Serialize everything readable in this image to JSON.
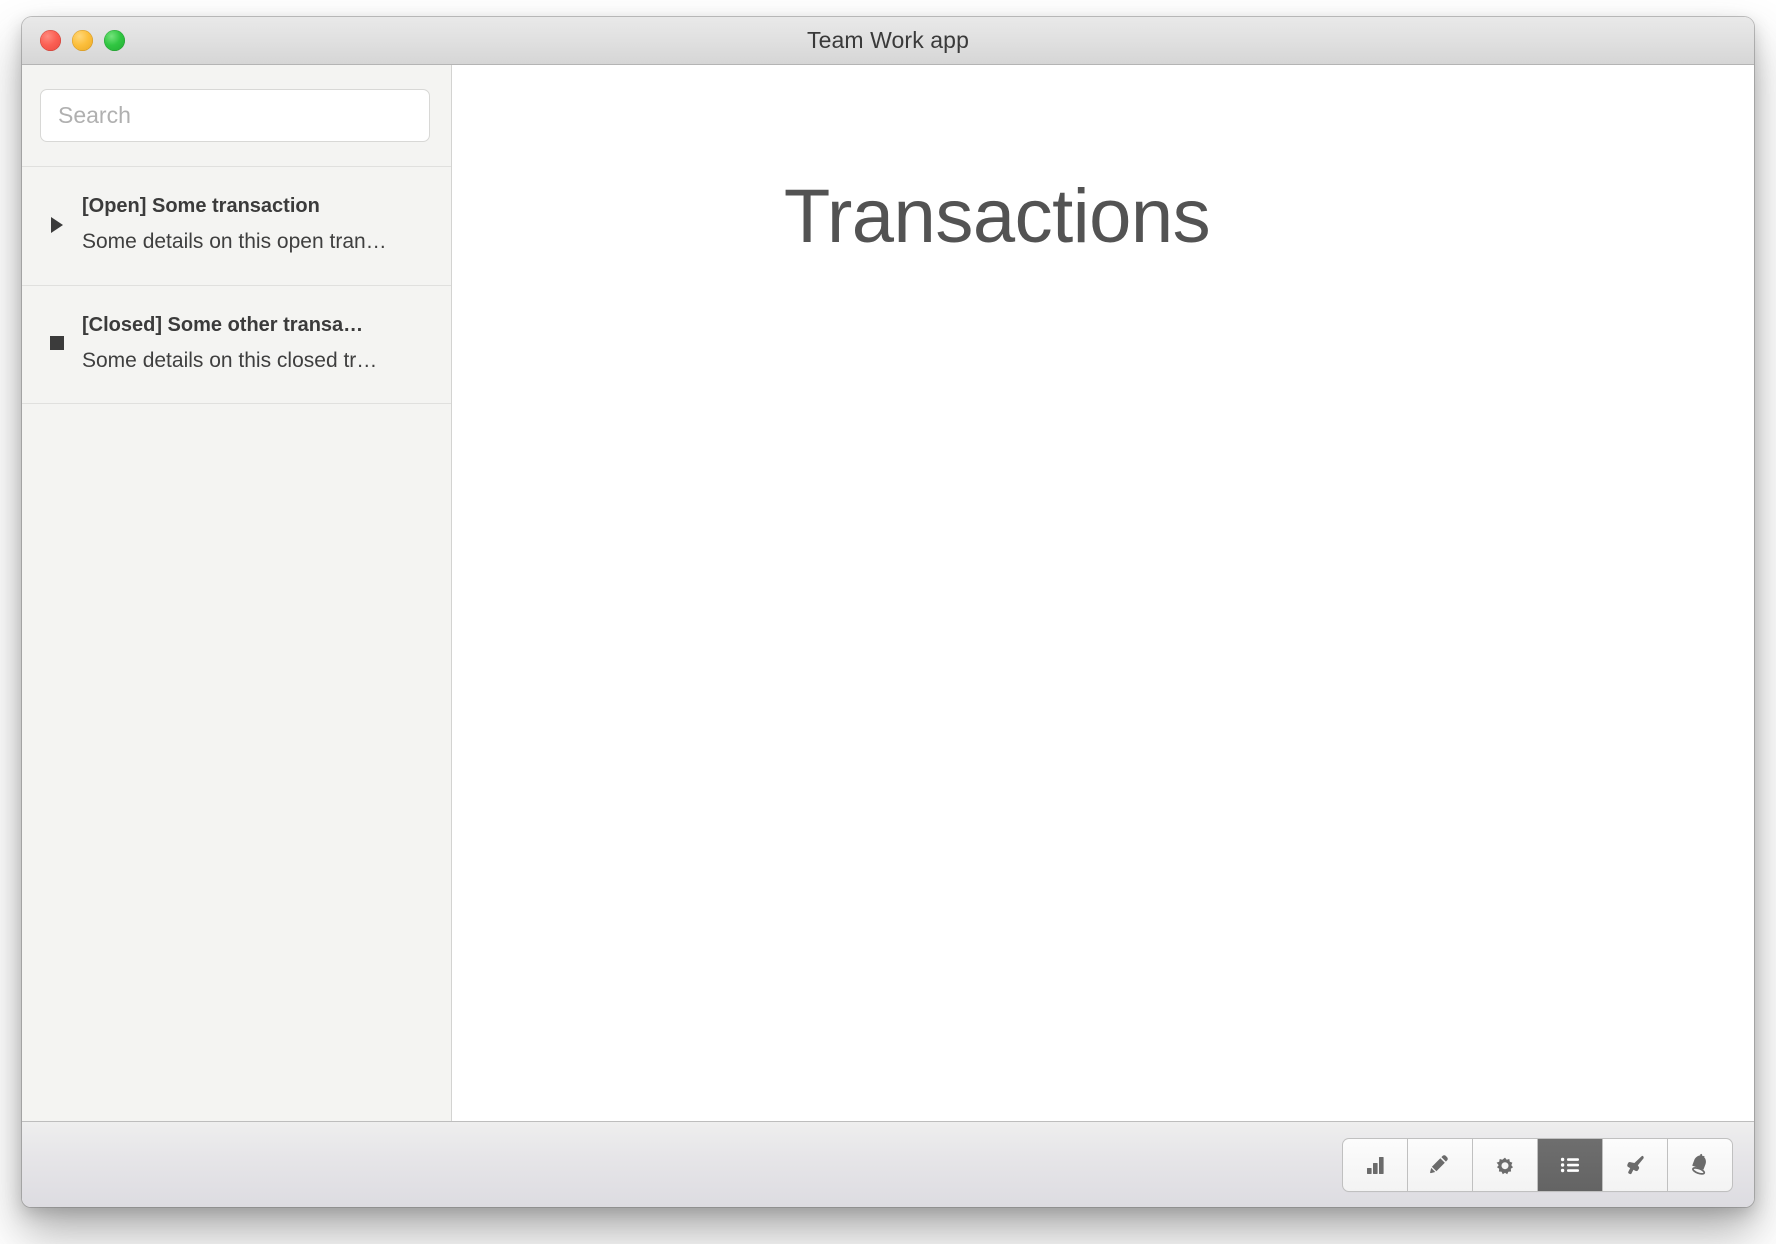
{
  "window": {
    "title": "Team Work app",
    "traffic_lights": [
      {
        "name": "close-button",
        "color": "#fb6054"
      },
      {
        "name": "minimize-button",
        "color": "#fcbf3c"
      },
      {
        "name": "zoom-button",
        "color": "#31c642"
      }
    ]
  },
  "sidebar": {
    "search": {
      "placeholder": "Search",
      "value": ""
    },
    "transactions": [
      {
        "icon": "triangle-play-icon",
        "status": "Open",
        "title": "[Open] Some transaction",
        "detail": "Some details on this open tran…"
      },
      {
        "icon": "square-stop-icon",
        "status": "Closed",
        "title": "[Closed] Some other transa…",
        "detail": "Some details on this closed tr…"
      }
    ]
  },
  "main": {
    "title": "Transactions"
  },
  "toolbar": {
    "buttons": [
      {
        "icon": "bar-chart-icon",
        "label": "Statistics",
        "selected": false
      },
      {
        "icon": "pencil-icon",
        "label": "Edit",
        "selected": false
      },
      {
        "icon": "gear-icon",
        "label": "Settings",
        "selected": false
      },
      {
        "icon": "list-icon",
        "label": "List",
        "selected": true
      },
      {
        "icon": "megaphone-icon",
        "label": "Announce",
        "selected": false
      },
      {
        "icon": "bell-icon",
        "label": "Alerts",
        "selected": false
      }
    ],
    "selected_color": "#666666"
  }
}
